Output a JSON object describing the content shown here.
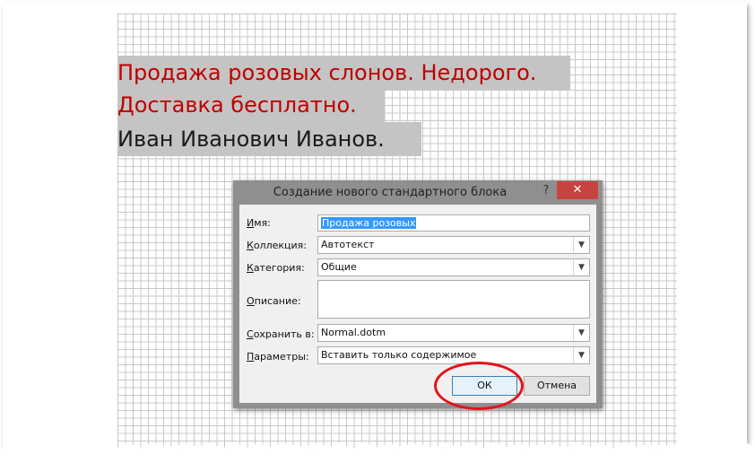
{
  "document": {
    "lines": [
      "Продажа розовых слонов. Недорого.",
      "Доставка бесплатно.",
      "Иван Иванович Иванов."
    ],
    "highlight_color": "#c4c4c4",
    "accent_text_color": "#c00000"
  },
  "dialog": {
    "title": "Создание нового стандартного блока",
    "help_label": "?",
    "close_icon": "close-icon",
    "fields": {
      "name": {
        "label_u": "И",
        "label_rest": "мя:",
        "value": "Продажа розовых"
      },
      "gallery": {
        "label_pre": "",
        "label_u": "К",
        "label_rest": "оллекция:",
        "value": "Автотекст"
      },
      "category": {
        "label_pre": "",
        "label_u": "К",
        "label_rest": "атегория:",
        "value": "Общие"
      },
      "description": {
        "label_u": "О",
        "label_rest": "писание:",
        "value": ""
      },
      "save_in": {
        "label_pre": "",
        "label_u": "С",
        "label_rest": "охранить в:",
        "value": "Normal.dotm"
      },
      "options": {
        "label_u": "П",
        "label_rest": "араметры:",
        "value": "Вставить только содержимое"
      }
    },
    "ok_label": "ОК",
    "cancel_label": "Отмена"
  }
}
